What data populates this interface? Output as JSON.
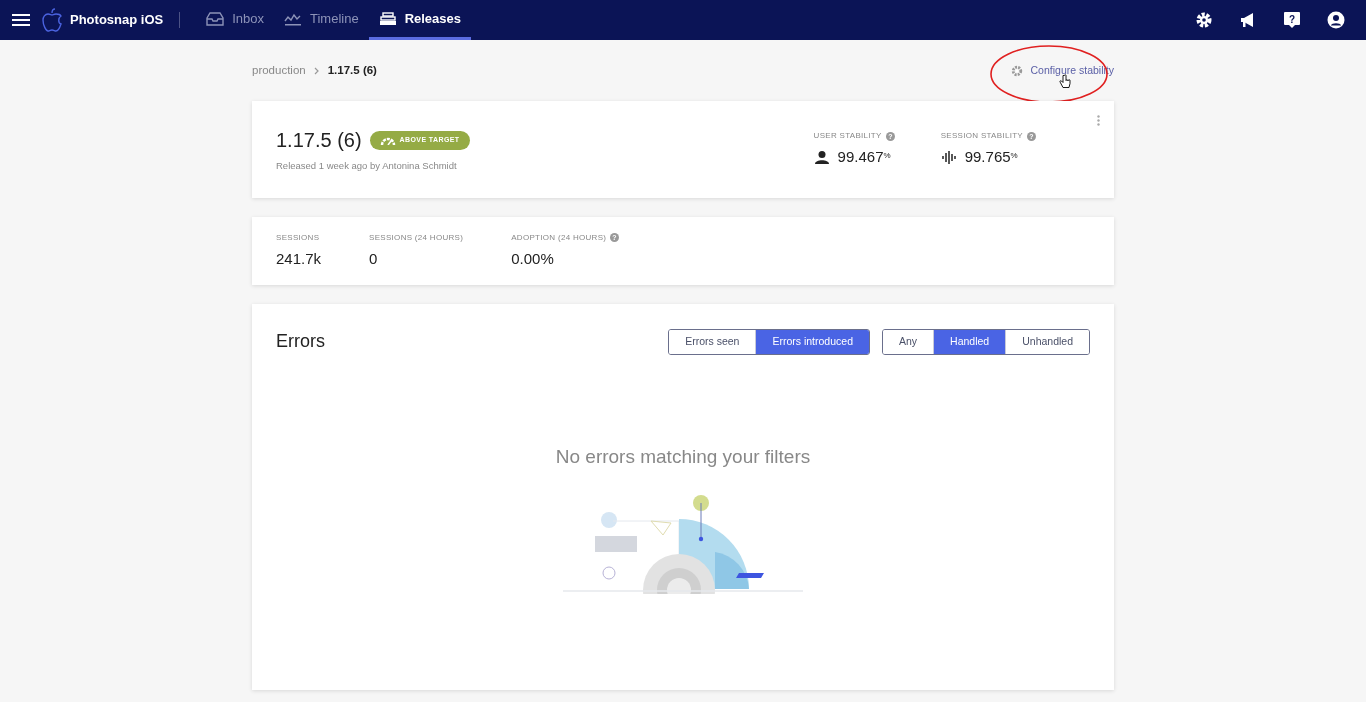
{
  "app": {
    "name": "Photosnap iOS",
    "help_icon_text": "?"
  },
  "tabs": [
    {
      "label": "Inbox",
      "selected": false
    },
    {
      "label": "Timeline",
      "selected": false
    },
    {
      "label": "Releases",
      "selected": true
    }
  ],
  "breadcrumb": [
    "production",
    "1.17.5 (6)"
  ],
  "configure_link": "Configure stability",
  "release": {
    "version": "1.17.5 (6)",
    "badge": "ABOVE TARGET",
    "subtitle": "Released 1 week ago by Antonina Schmidt",
    "stats": [
      {
        "label": "USER STABILITY",
        "help": "?",
        "value": "99.467",
        "unit": "%"
      },
      {
        "label": "SESSION STABILITY",
        "help": "?",
        "value": "99.765",
        "unit": "%"
      }
    ]
  },
  "metrics": [
    {
      "label": "SESSIONS",
      "value": "241.7k"
    },
    {
      "label": "SESSIONS (24 HOURS)",
      "value": "0"
    },
    {
      "label": "ADOPTION (24 HOURS)",
      "value": "0.00%",
      "help": "?"
    }
  ],
  "errors": {
    "title": "Errors",
    "empty_message": "No errors matching your filters",
    "filter_groups": [
      [
        {
          "label": "Errors seen",
          "selected": false
        },
        {
          "label": "Errors introduced",
          "selected": true
        }
      ],
      [
        {
          "label": "Any",
          "selected": false
        },
        {
          "label": "Handled",
          "selected": true
        },
        {
          "label": "Unhandled",
          "selected": false
        }
      ]
    ]
  }
}
